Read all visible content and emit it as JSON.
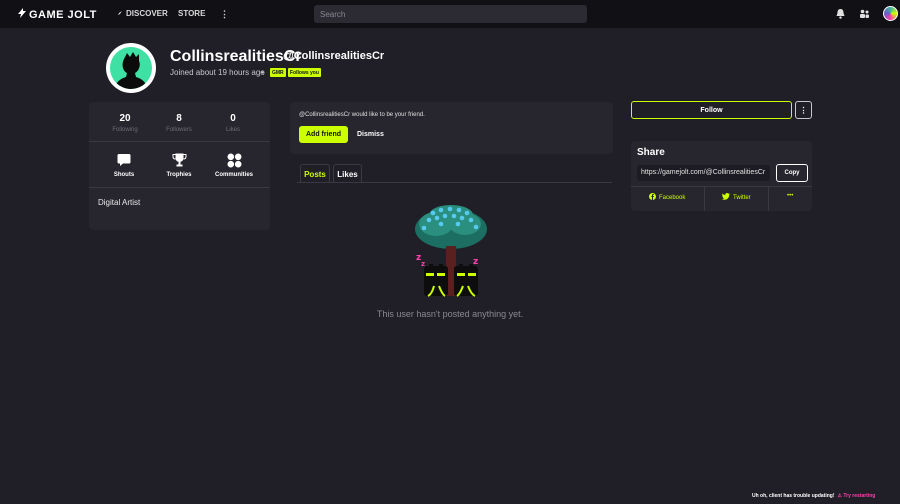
{
  "topbar": {
    "logo_text": "GAME JOLT",
    "nav": [
      {
        "label": "DISCOVER"
      },
      {
        "label": "STORE"
      }
    ],
    "search_placeholder": "Search"
  },
  "profile": {
    "display_name": "CollinsrealitiesCr",
    "username": "@CollinsrealitiesCr",
    "joined": "Joined about 19 hours ago",
    "separator": "•",
    "tags": [
      "GMR",
      "Follows you"
    ]
  },
  "stats": [
    {
      "value": "20",
      "label": "Following"
    },
    {
      "value": "8",
      "label": "Followers"
    },
    {
      "value": "0",
      "label": "Likes"
    }
  ],
  "quick_links": [
    {
      "label": "Shouts",
      "icon": "chat-bubble-icon"
    },
    {
      "label": "Trophies",
      "icon": "trophy-icon"
    },
    {
      "label": "Communities",
      "icon": "communities-icon"
    }
  ],
  "bio": "Digital Artist",
  "friend_request": {
    "text": "@CollinsrealitiesCr would like to be your friend.",
    "add_label": "Add friend",
    "dismiss_label": "Dismiss"
  },
  "tabs": [
    {
      "label": "Posts",
      "active": true
    },
    {
      "label": "Likes",
      "active": false
    }
  ],
  "empty_message": "This user hasn't posted anything yet.",
  "actions": {
    "follow_label": "Follow",
    "more_label": "⋮"
  },
  "share": {
    "title": "Share",
    "url": "https://gamejolt.com/@CollinsrealitiesCr",
    "copy_label": "Copy",
    "links": [
      {
        "label": "Facebook",
        "icon": "facebook-icon"
      },
      {
        "label": "Twitter",
        "icon": "twitter-icon"
      },
      {
        "label": "•••",
        "icon": "more-icon"
      }
    ]
  },
  "toast": {
    "message": "Uh oh, client has trouble updating!",
    "action": "Try restarting"
  },
  "colors": {
    "accent": "#ccff00",
    "background": "#201e27",
    "card": "#27252e",
    "topbar": "#111015",
    "pink": "#ff3fac",
    "teal": "#3fb4a0"
  }
}
